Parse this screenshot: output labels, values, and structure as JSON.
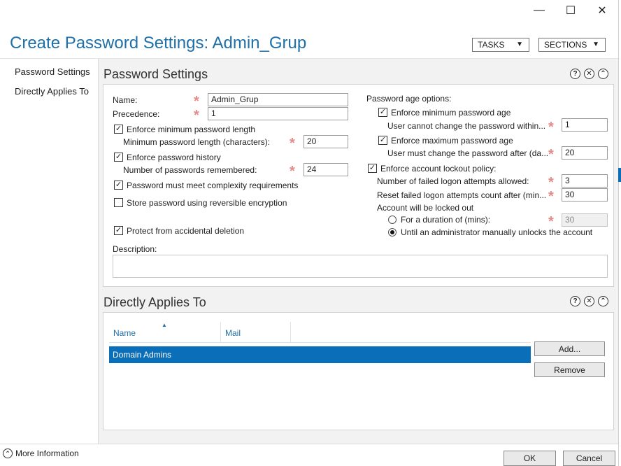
{
  "window": {
    "title": "Create Password Settings: Admin_Grup",
    "caption": {
      "minimize": "—",
      "maximize": "☐",
      "close": "✕"
    }
  },
  "toolbar": {
    "tasks_label": "TASKS",
    "sections_label": "SECTIONS",
    "arrow": "▼"
  },
  "nav": {
    "items": [
      "Password Settings",
      "Directly Applies To"
    ]
  },
  "password_settings": {
    "section_title": "Password Settings",
    "help_glyph": "?",
    "close_glyph": "✕",
    "collapse_glyph": "⌃",
    "required_mark": "*",
    "check_mark": "✓",
    "name_label": "Name:",
    "name_value": "Admin_Grup",
    "precedence_label": "Precedence:",
    "precedence_value": "1",
    "enforce_min_length_label": "Enforce minimum password length",
    "min_length_label": "Minimum password length (characters):",
    "min_length_value": "20",
    "enforce_history_label": "Enforce password history",
    "history_label": "Number of passwords remembered:",
    "history_value": "24",
    "complexity_label": "Password must meet complexity requirements",
    "reversible_label": "Store password using reversible encryption",
    "protect_label": "Protect from accidental deletion",
    "description_label": "Description:",
    "description_value": "",
    "age_options_label": "Password age options:",
    "enforce_min_age_label": "Enforce minimum password age",
    "min_age_label": "User cannot change the password within...",
    "min_age_value": "1",
    "enforce_max_age_label": "Enforce maximum password age",
    "max_age_label": "User must change the password after (da...",
    "max_age_value": "20",
    "lockout_label": "Enforce account lockout policy:",
    "failed_attempts_label": "Number of failed logon attempts allowed:",
    "failed_attempts_value": "3",
    "reset_label": "Reset failed logon attempts count after (min...",
    "reset_value": "30",
    "locked_out_label": "Account will be locked out",
    "duration_label": "For a duration of (mins):",
    "duration_value": "30",
    "manual_unlock_label": "Until an administrator manually unlocks the account",
    "checked": {
      "enforce_min_length": true,
      "enforce_history": true,
      "complexity": true,
      "reversible": false,
      "protect": true,
      "enforce_min_age": true,
      "enforce_max_age": true,
      "lockout": true
    },
    "lockout_mode": "manual"
  },
  "applies_to": {
    "section_title": "Directly Applies To",
    "columns": [
      "Name",
      "Mail"
    ],
    "sort_indicator": "▲",
    "rows": [
      {
        "name": "Domain Admins",
        "mail": ""
      }
    ],
    "add_label": "Add...",
    "remove_label": "Remove"
  },
  "footer": {
    "more_info_label": "More Information",
    "more_info_glyph": "⌃",
    "ok_label": "OK",
    "cancel_label": "Cancel"
  },
  "colors": {
    "title": "#1f6fa8",
    "selection": "#0a6fb8",
    "required": "#e88a8a",
    "content_bg": "#f2f2f2"
  }
}
